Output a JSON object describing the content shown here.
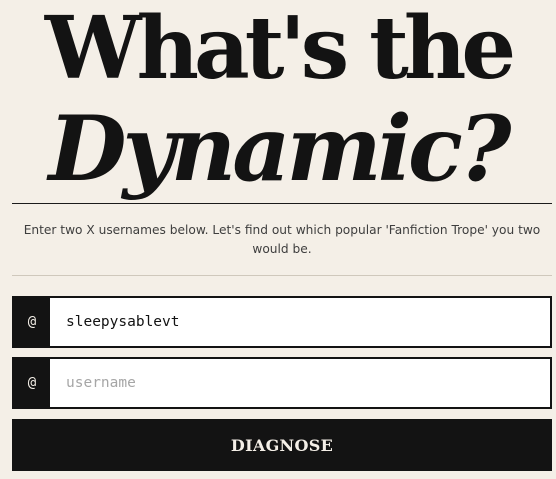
{
  "header": {
    "title_line1": "What's the",
    "title_line2": "Dynamic?"
  },
  "intro": {
    "text": "Enter two X usernames below. Let's find out which popular 'Fanfiction Trope' you two would be."
  },
  "form": {
    "prefix_symbol": "@",
    "username1": {
      "value": "sleepysablevt",
      "placeholder": ""
    },
    "username2": {
      "value": "",
      "placeholder": "username"
    },
    "submit_label": "DIAGNOSE"
  },
  "colors": {
    "background": "#f4efe7",
    "ink": "#131313",
    "placeholder": "#a6a6a6"
  }
}
